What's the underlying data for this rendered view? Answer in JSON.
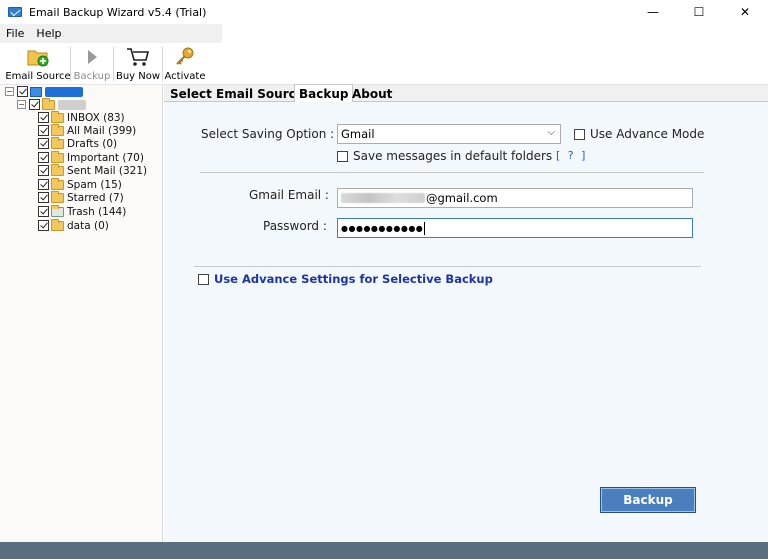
{
  "window": {
    "title": "Email Backup Wizard v5.4 (Trial)",
    "minimize": "—",
    "maximize": "☐",
    "close": "✕"
  },
  "menu": [
    "File",
    "Help"
  ],
  "toolbar": {
    "email_source": "Email Source",
    "backup": "Backup",
    "buy_now": "Buy Now",
    "activate": "Activate"
  },
  "tree": {
    "folders": [
      {
        "label": "INBOX (83)"
      },
      {
        "label": "All Mail (399)"
      },
      {
        "label": "Drafts (0)"
      },
      {
        "label": "Important (70)"
      },
      {
        "label": "Sent Mail (321)"
      },
      {
        "label": "Spam (15)"
      },
      {
        "label": "Starred (7)"
      },
      {
        "label": "Trash (144)"
      },
      {
        "label": "data (0)"
      }
    ]
  },
  "tabs": [
    "Select Email Source",
    "Backup",
    "About"
  ],
  "active_tab": "Backup",
  "backup_form": {
    "saving_option_label": "Select Saving Option :",
    "saving_option_value": "Gmail",
    "use_advance_mode": "Use Advance Mode",
    "save_default_folders": "Save messages in default folders",
    "help": "[ ? ]",
    "email_label": "Gmail Email :",
    "email_value": "@gmail.com",
    "password_label": "Password :",
    "password_value": "●●●●●●●●●●●",
    "advance_settings": "Use Advance Settings for Selective Backup",
    "backup_button": "Backup"
  },
  "colors": {
    "accent": "#4a7fbf",
    "content_bg": "#f3f8fd",
    "link": "#1c34a8",
    "statusbar": "#5b6d80"
  }
}
